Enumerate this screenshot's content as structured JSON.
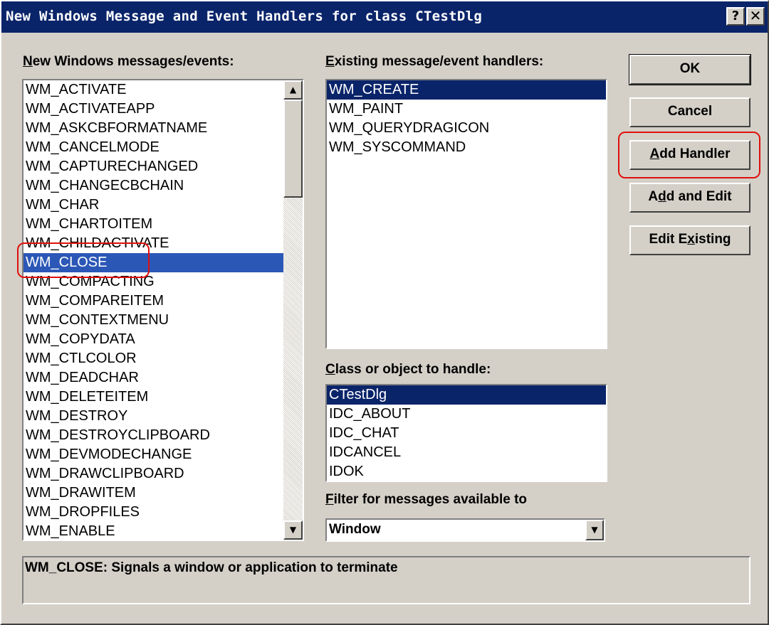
{
  "window": {
    "title": "New Windows Message and Event Handlers for class CTestDlg",
    "help_label": "?",
    "close_label": "✕"
  },
  "messages": {
    "label_hotkey": "N",
    "label_rest": "ew Windows messages/events:",
    "items": [
      "WM_ACTIVATE",
      "WM_ACTIVATEAPP",
      "WM_ASKCBFORMATNAME",
      "WM_CANCELMODE",
      "WM_CAPTURECHANGED",
      "WM_CHANGECBCHAIN",
      "WM_CHAR",
      "WM_CHARTOITEM",
      "WM_CHILDACTIVATE",
      "WM_CLOSE",
      "WM_COMPACTING",
      "WM_COMPAREITEM",
      "WM_CONTEXTMENU",
      "WM_COPYDATA",
      "WM_CTLCOLOR",
      "WM_DEADCHAR",
      "WM_DELETEITEM",
      "WM_DESTROY",
      "WM_DESTROYCLIPBOARD",
      "WM_DEVMODECHANGE",
      "WM_DRAWCLIPBOARD",
      "WM_DRAWITEM",
      "WM_DROPFILES",
      "WM_ENABLE"
    ],
    "selected": "WM_CLOSE",
    "scroll_up_icon": "▲",
    "scroll_down_icon": "▼"
  },
  "existing": {
    "label_hotkey": "E",
    "label_rest": "xisting message/event handlers:",
    "items": [
      "WM_CREATE",
      "WM_PAINT",
      "WM_QUERYDRAGICON",
      "WM_SYSCOMMAND"
    ],
    "selected": "WM_CREATE"
  },
  "class_obj": {
    "label_hotkey": "C",
    "label_rest": "lass or object to handle:",
    "items": [
      "CTestDlg",
      "IDC_ABOUT",
      "IDC_CHAT",
      "IDCANCEL",
      "IDOK"
    ],
    "selected": "CTestDlg"
  },
  "filter": {
    "label_hotkey": "F",
    "label_rest": "ilter for messages available to",
    "value": "Window",
    "arrow_icon": "▼"
  },
  "buttons": {
    "ok": "OK",
    "cancel": "Cancel",
    "add_handler_hotkey": "A",
    "add_handler_rest": "dd Handler",
    "add_edit_pre": "A",
    "add_edit_hotkey": "d",
    "add_edit_rest": "d and Edit",
    "edit_existing_pre": "Edit E",
    "edit_existing_hotkey": "x",
    "edit_existing_rest": "isting"
  },
  "description": "WM_CLOSE:  Signals a window or application to terminate",
  "colors": {
    "title_bar": "#0a246a",
    "selection": "#2b57b6",
    "callout": "#e0100c",
    "dialog_face": "#d4d0c8"
  }
}
